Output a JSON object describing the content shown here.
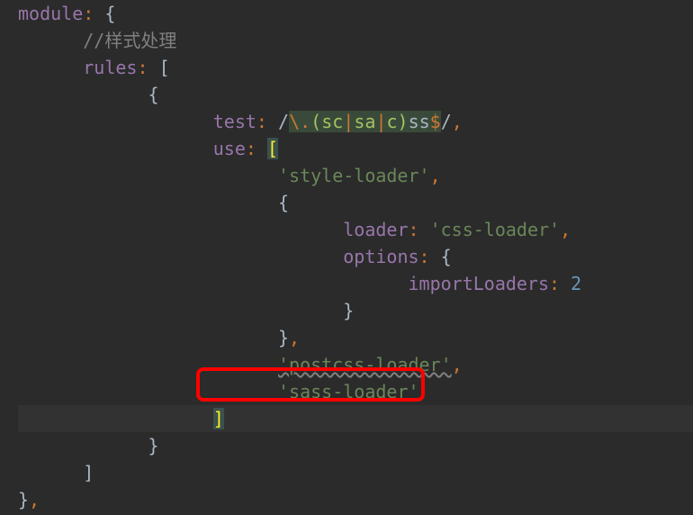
{
  "code": {
    "module_key": "module",
    "comment": "//样式处理",
    "rules_key": "rules",
    "test_key": "test",
    "regex": {
      "open": "/",
      "esc_dot": "\\.",
      "paren_open": "(",
      "g1": "sc",
      "pipe1": "|",
      "g2": "sa",
      "pipe2": "|",
      "g3": "c",
      "paren_close": ")",
      "suffix": "ss",
      "dollar": "$",
      "close": "/"
    },
    "use_key": "use",
    "style_loader": "'style-loader'",
    "loader_key": "loader",
    "css_loader": "'css-loader'",
    "options_key": "options",
    "import_loaders_key": "importLoaders",
    "import_loaders_val": "2",
    "postcss_loader": "'postcss-loader'",
    "sass_loader": "'sass-loader'"
  }
}
